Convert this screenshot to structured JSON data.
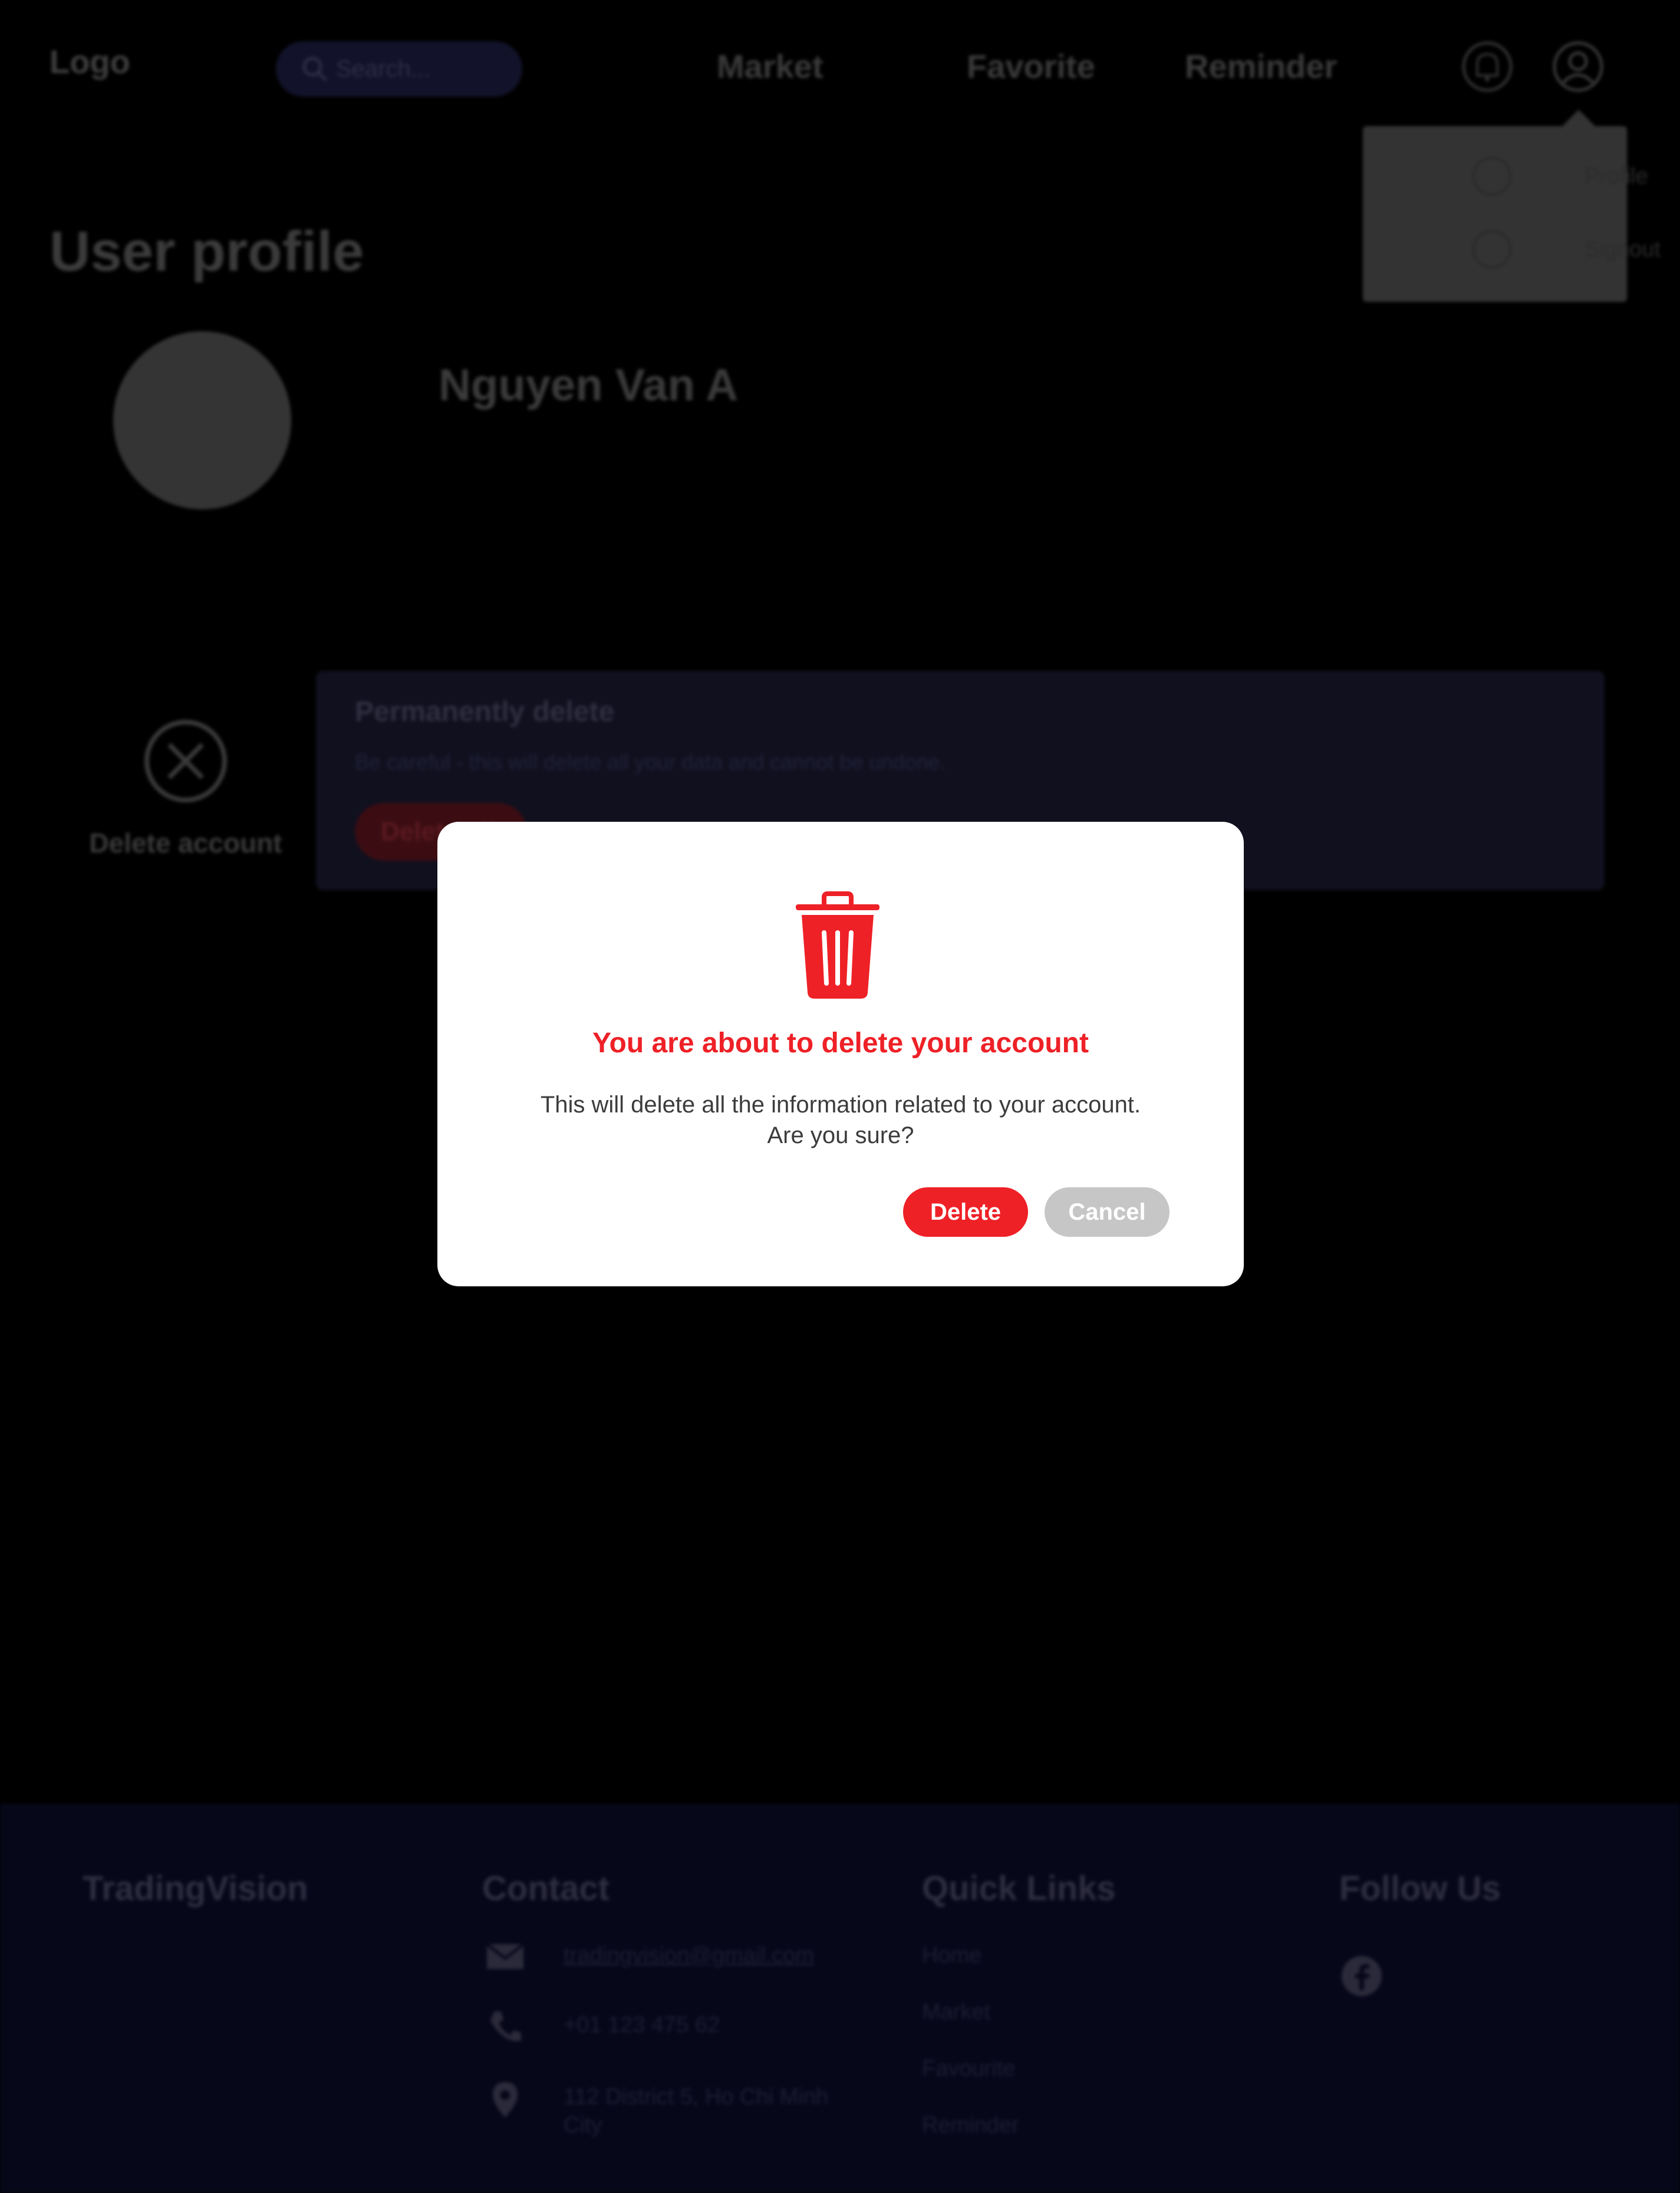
{
  "nav": {
    "logo": "Logo",
    "search_placeholder": "Search...",
    "links": [
      "Market",
      "Favorite",
      "Reminder"
    ]
  },
  "dropdown": {
    "items": [
      "Profile",
      "Signout"
    ]
  },
  "profile": {
    "title": "User profile",
    "name": "Nguyen Van A"
  },
  "delete_section": {
    "side_label": "Delete account",
    "card_title": "Permanently delete",
    "card_text": "Be careful - this will delete all your data and cannot be undone.",
    "card_button": "Delete all"
  },
  "modal": {
    "title": "You are about to delete your account",
    "message_line1": "This will delete all the information related to your account.",
    "message_line2": "Are you sure?",
    "delete_label": "Delete",
    "cancel_label": "Cancel"
  },
  "footer": {
    "brand": "TradingVision",
    "contact_title": "Contact",
    "email": "tradingvision@gmail.com",
    "phone": "+01 123 475 62",
    "address_line1": "112 District 5, Ho Chi Minh",
    "address_line2": "City",
    "links_title": "Quick Links",
    "links": [
      "Home",
      "Market",
      "Favourite",
      "Reminder"
    ],
    "follow_title": "Follow Us"
  },
  "colors": {
    "accent_red": "#ee2127",
    "cancel_gray": "#c6c6c6",
    "overlay": "#000000"
  },
  "icons": [
    "search-icon",
    "bell-icon",
    "user-icon",
    "close-circle-icon",
    "mail-icon",
    "phone-icon",
    "location-icon",
    "facebook-icon",
    "trash-icon"
  ]
}
